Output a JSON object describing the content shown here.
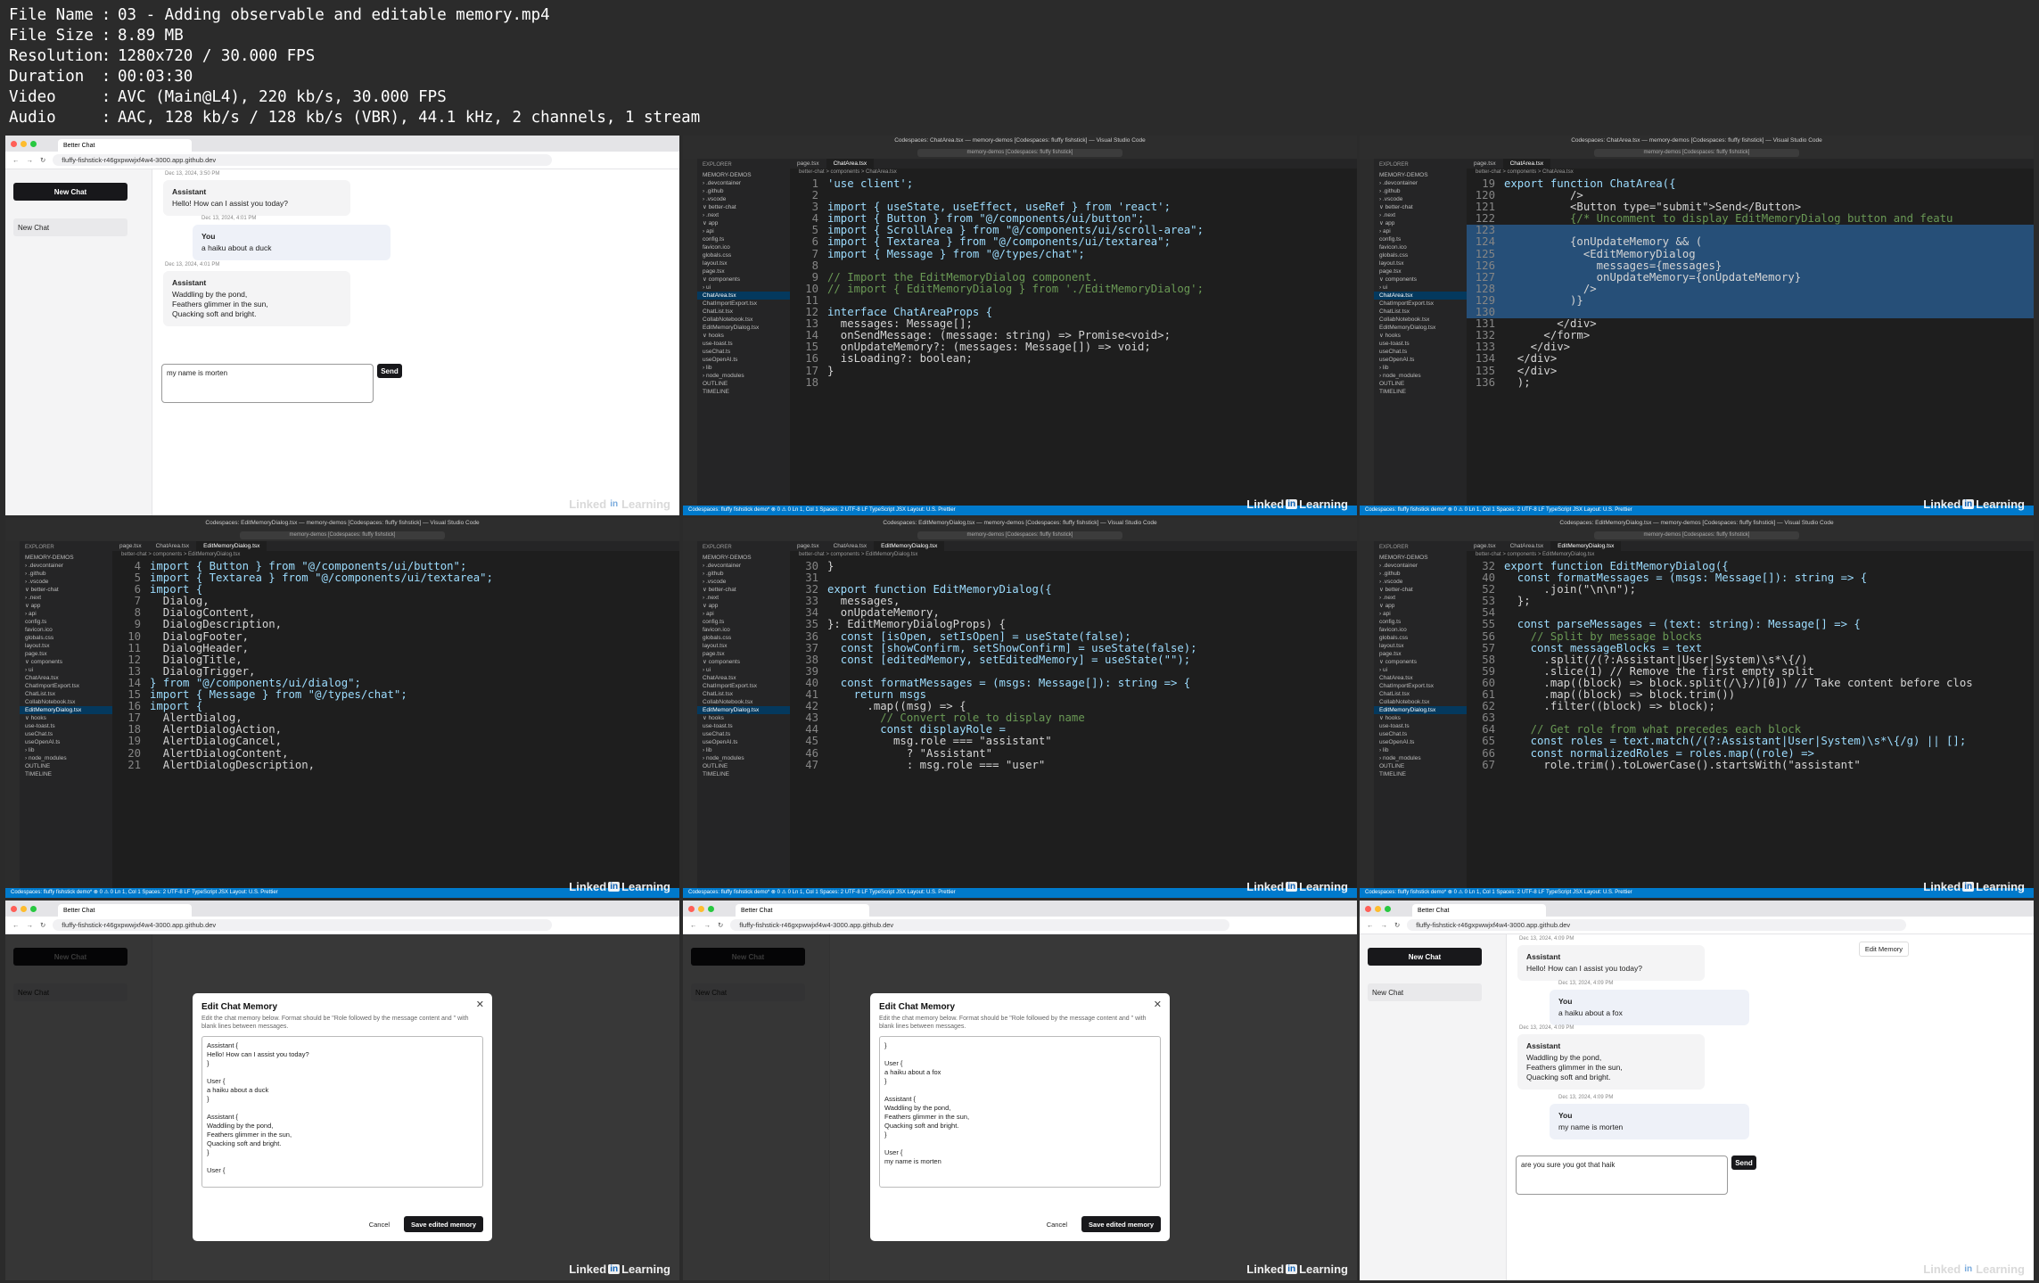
{
  "file_info": [
    {
      "key": "File Name",
      "value": "03 - Adding observable and editable memory.mp4"
    },
    {
      "key": "File Size",
      "value": "8.89 MB"
    },
    {
      "key": "Resolution",
      "value": "1280x720 / 30.000 FPS"
    },
    {
      "key": "Duration",
      "value": "00:03:30"
    },
    {
      "key": "Video",
      "value": "AVC (Main@L4), 220 kb/s, 30.000 FPS"
    },
    {
      "key": "Audio",
      "value": "AAC, 128 kb/s / 128 kb/s (VBR), 44.1 kHz, 2 channels, 1 stream"
    }
  ],
  "watermark": "Linked",
  "watermark_in": "in",
  "watermark_suffix": "Learning",
  "browser": {
    "tab": "Better Chat",
    "url": "fluffy-fishstick-r46gxpwwjxf4w4-3000.app.github.dev",
    "new_chat": "New Chat",
    "chat_item": "New Chat",
    "send": "Send",
    "edit_memory": "Edit Memory"
  },
  "t1": {
    "ts1": "Dec 13, 2024, 3:50 PM",
    "a1_role": "Assistant",
    "a1_text": "Hello! How can I assist you today?",
    "ts2": "Dec 13, 2024, 4:01 PM",
    "u1_role": "You",
    "u1_text": "a haiku about a duck",
    "ts3": "Dec 13, 2024, 4:01 PM",
    "a2_role": "Assistant",
    "a2_text": "Waddling by the pond,\nFeathers glimmer in the sun,\nQuacking soft and bright.",
    "input": "my name is morten"
  },
  "t9": {
    "ts1": "Dec 13, 2024, 4:09 PM",
    "a1_role": "Assistant",
    "a1_text": "Hello! How can I assist you today?",
    "ts2": "Dec 13, 2024, 4:09 PM",
    "u1_role": "You",
    "u1_text": "a haiku about a fox",
    "ts3": "Dec 13, 2024, 4:09 PM",
    "a2_role": "Assistant",
    "a2_text": "Waddling by the pond,\nFeathers glimmer in the sun,\nQuacking soft and bright.",
    "ts4": "Dec 13, 2024, 4:09 PM",
    "u2_role": "You",
    "u2_text": "my name is morten",
    "input": "are you sure you got that haik"
  },
  "dialog": {
    "title": "Edit Chat Memory",
    "desc": "Edit the chat memory below. Format should be \"Role followed by the message content and \" with blank lines between messages.",
    "mem7": "Assistant {\nHello! How can I assist you today?\n}\n\nUser {\na haiku about a duck\n}\n\nAssistant {\nWaddling by the pond,\nFeathers glimmer in the sun,\nQuacking soft and bright.\n}\n\nUser {",
    "mem8": "}\n\nUser {\na haiku about a fox\n}\n\nAssistant {\nWaddling by the pond,\nFeathers glimmer in the sun,\nQuacking soft and bright.\n}\n\nUser {\nmy name is morten",
    "cancel": "Cancel",
    "save": "Save edited memory"
  },
  "vscode": {
    "title_chatarea": "Codespaces: ChatArea.tsx — memory-demos [Codespaces: fluffy fishstick] — Visual Studio Code",
    "title_dialog": "Codespaces: EditMemoryDialog.tsx — memory-demos [Codespaces: fluffy fishstick] — Visual Studio Code",
    "search": "memory-demos [Codespaces: fluffy fishstick]",
    "explorer": "EXPLORER",
    "status": "Codespaces: fluffy fishstick   demo*   ⊗ 0 ⚠ 0   Ln 1, Col 1   Spaces: 2   UTF-8   LF   TypeScript JSX   Layout: U.S.   Prettier",
    "tabs_chatarea": [
      "page.tsx",
      "ChatArea.tsx"
    ],
    "tabs_dialog": [
      "page.tsx",
      "ChatArea.tsx",
      "EditMemoryDialog.tsx"
    ],
    "bc_chatarea": "better-chat > components > ChatArea.tsx",
    "bc_dialog": "better-chat > components > EditMemoryDialog.tsx",
    "files": [
      "MEMORY-DEMOS",
      "› .devcontainer",
      "› .github",
      "› .vscode",
      "∨ better-chat",
      "  › .next",
      "  ∨ app",
      "    › api",
      "    config.ts",
      "    favicon.ico",
      "    globals.css",
      "    layout.tsx",
      "    page.tsx",
      "  ∨ components",
      "    › ui",
      "    ChatArea.tsx",
      "    ChatImportExport.tsx",
      "    ChatList.tsx",
      "    CollabNotebook.tsx",
      "    EditMemoryDialog.tsx",
      "  ∨ hooks",
      "    use-toast.ts",
      "    useChat.ts",
      "    useOpenAI.ts",
      "  › lib",
      "  › node_modules",
      "OUTLINE",
      "TIMELINE"
    ]
  },
  "code2": [
    {
      "n": "1",
      "t": "'use client';"
    },
    {
      "n": "2",
      "t": ""
    },
    {
      "n": "3",
      "t": "import { useState, useEffect, useRef } from 'react';"
    },
    {
      "n": "4",
      "t": "import { Button } from \"@/components/ui/button\";"
    },
    {
      "n": "5",
      "t": "import { ScrollArea } from \"@/components/ui/scroll-area\";"
    },
    {
      "n": "6",
      "t": "import { Textarea } from \"@/components/ui/textarea\";"
    },
    {
      "n": "7",
      "t": "import { Message } from \"@/types/chat\";"
    },
    {
      "n": "8",
      "t": ""
    },
    {
      "n": "9",
      "t": "// Import the EditMemoryDialog component."
    },
    {
      "n": "10",
      "t": "// import { EditMemoryDialog } from './EditMemoryDialog';"
    },
    {
      "n": "11",
      "t": ""
    },
    {
      "n": "12",
      "t": "interface ChatAreaProps {"
    },
    {
      "n": "13",
      "t": "  messages: Message[];"
    },
    {
      "n": "14",
      "t": "  onSendMessage: (message: string) => Promise<void>;"
    },
    {
      "n": "15",
      "t": "  onUpdateMemory?: (messages: Message[]) => void;"
    },
    {
      "n": "16",
      "t": "  isLoading?: boolean;"
    },
    {
      "n": "17",
      "t": "}"
    },
    {
      "n": "18",
      "t": ""
    }
  ],
  "code3": [
    {
      "n": "19",
      "t": "export function ChatArea({",
      "h": false
    },
    {
      "n": "120",
      "t": "          />",
      "h": false
    },
    {
      "n": "121",
      "t": "          <Button type=\"submit\">Send</Button>",
      "h": false
    },
    {
      "n": "122",
      "t": "          {/* Uncomment to display EditMemoryDialog button and featu",
      "h": false
    },
    {
      "n": "123",
      "t": "",
      "h": true
    },
    {
      "n": "124",
      "t": "          {onUpdateMemory && (",
      "h": true
    },
    {
      "n": "125",
      "t": "            <EditMemoryDialog",
      "h": true
    },
    {
      "n": "126",
      "t": "              messages={messages}",
      "h": true
    },
    {
      "n": "127",
      "t": "              onUpdateMemory={onUpdateMemory}",
      "h": true
    },
    {
      "n": "128",
      "t": "            />",
      "h": true
    },
    {
      "n": "129",
      "t": "          )}",
      "h": true
    },
    {
      "n": "130",
      "t": "          ",
      "h": true
    },
    {
      "n": "131",
      "t": "        </div>",
      "h": false
    },
    {
      "n": "132",
      "t": "      </form>",
      "h": false
    },
    {
      "n": "133",
      "t": "    </div>",
      "h": false
    },
    {
      "n": "134",
      "t": "  </div>",
      "h": false
    },
    {
      "n": "135",
      "t": "  </div>",
      "h": false
    },
    {
      "n": "136",
      "t": "  );",
      "h": false
    }
  ],
  "code4": [
    {
      "n": "4",
      "t": "import { Button } from \"@/components/ui/button\";"
    },
    {
      "n": "5",
      "t": "import { Textarea } from \"@/components/ui/textarea\";"
    },
    {
      "n": "6",
      "t": "import {"
    },
    {
      "n": "7",
      "t": "  Dialog,"
    },
    {
      "n": "8",
      "t": "  DialogContent,"
    },
    {
      "n": "9",
      "t": "  DialogDescription,"
    },
    {
      "n": "10",
      "t": "  DialogFooter,"
    },
    {
      "n": "11",
      "t": "  DialogHeader,"
    },
    {
      "n": "12",
      "t": "  DialogTitle,"
    },
    {
      "n": "13",
      "t": "  DialogTrigger,"
    },
    {
      "n": "14",
      "t": "} from \"@/components/ui/dialog\";"
    },
    {
      "n": "15",
      "t": "import { Message } from \"@/types/chat\";"
    },
    {
      "n": "16",
      "t": "import {"
    },
    {
      "n": "17",
      "t": "  AlertDialog,"
    },
    {
      "n": "18",
      "t": "  AlertDialogAction,"
    },
    {
      "n": "19",
      "t": "  AlertDialogCancel,"
    },
    {
      "n": "20",
      "t": "  AlertDialogContent,"
    },
    {
      "n": "21",
      "t": "  AlertDialogDescription,"
    }
  ],
  "code5": [
    {
      "n": "30",
      "t": "}"
    },
    {
      "n": "31",
      "t": ""
    },
    {
      "n": "32",
      "t": "export function EditMemoryDialog({"
    },
    {
      "n": "33",
      "t": "  messages,"
    },
    {
      "n": "34",
      "t": "  onUpdateMemory,"
    },
    {
      "n": "35",
      "t": "}: EditMemoryDialogProps) {"
    },
    {
      "n": "36",
      "t": "  const [isOpen, setIsOpen] = useState(false);"
    },
    {
      "n": "37",
      "t": "  const [showConfirm, setShowConfirm] = useState(false);"
    },
    {
      "n": "38",
      "t": "  const [editedMemory, setEditedMemory] = useState(\"\");"
    },
    {
      "n": "39",
      "t": ""
    },
    {
      "n": "40",
      "t": "  const formatMessages = (msgs: Message[]): string => {"
    },
    {
      "n": "41",
      "t": "    return msgs"
    },
    {
      "n": "42",
      "t": "      .map((msg) => {"
    },
    {
      "n": "43",
      "t": "        // Convert role to display name"
    },
    {
      "n": "44",
      "t": "        const displayRole ="
    },
    {
      "n": "45",
      "t": "          msg.role === \"assistant\""
    },
    {
      "n": "46",
      "t": "            ? \"Assistant\""
    },
    {
      "n": "47",
      "t": "            : msg.role === \"user\""
    }
  ],
  "code6": [
    {
      "n": "32",
      "t": "export function EditMemoryDialog({"
    },
    {
      "n": "40",
      "t": "  const formatMessages = (msgs: Message[]): string => {"
    },
    {
      "n": "52",
      "t": "      .join(\"\\n\\n\");"
    },
    {
      "n": "53",
      "t": "  };"
    },
    {
      "n": "54",
      "t": ""
    },
    {
      "n": "55",
      "t": "  const parseMessages = (text: string): Message[] => {"
    },
    {
      "n": "56",
      "t": "    // Split by message blocks"
    },
    {
      "n": "57",
      "t": "    const messageBlocks = text"
    },
    {
      "n": "58",
      "t": "      .split(/(?:Assistant|User|System)\\s*\\{/)"
    },
    {
      "n": "59",
      "t": "      .slice(1) // Remove the first empty split"
    },
    {
      "n": "60",
      "t": "      .map((block) => block.split(/\\}/)[0]) // Take content before clos"
    },
    {
      "n": "61",
      "t": "      .map((block) => block.trim())"
    },
    {
      "n": "62",
      "t": "      .filter((block) => block);"
    },
    {
      "n": "63",
      "t": ""
    },
    {
      "n": "64",
      "t": "    // Get role from what precedes each block"
    },
    {
      "n": "65",
      "t": "    const roles = text.match(/(?:Assistant|User|System)\\s*\\{/g) || [];"
    },
    {
      "n": "66",
      "t": "    const normalizedRoles = roles.map((role) =>"
    },
    {
      "n": "67",
      "t": "      role.trim().toLowerCase().startsWith(\"assistant\""
    }
  ]
}
